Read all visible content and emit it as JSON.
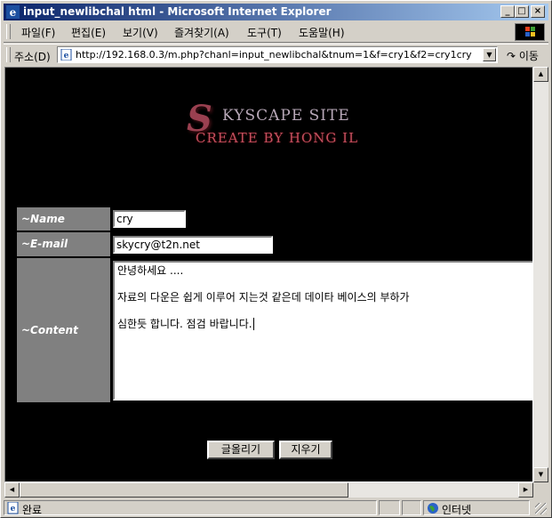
{
  "window": {
    "title": "input_newlibchal html - Microsoft Internet Explorer"
  },
  "titlebar_buttons": {
    "minimize": "_",
    "maximize": "□",
    "close": "×"
  },
  "menu": [
    {
      "label": "파일(F)"
    },
    {
      "label": "편집(E)"
    },
    {
      "label": "보기(V)"
    },
    {
      "label": "즐겨찾기(A)"
    },
    {
      "label": "도구(T)"
    },
    {
      "label": "도움말(H)"
    }
  ],
  "address": {
    "label": "주소(D)",
    "url": "http://192.168.0.3/m.php?chanl=input_newlibchal&tnum=1&f=cry1&f2=cry1cry",
    "go_label": "이동"
  },
  "logo": {
    "big_letter": "S",
    "line1": "KYSCAPE SITE",
    "line2": "CREATE BY HONG IL"
  },
  "form": {
    "name_label": "~Name",
    "name_value": "cry",
    "email_label": "~E-mail",
    "email_value": "skycry@t2n.net",
    "content_label": "~Content",
    "content_lines": [
      "안녕하세요 ....",
      "자료의 다운은 쉽게 이루어 지는것 같은데 데이타 베이스의 부하가",
      "심한듯 합니다. 점검 바랍니다."
    ],
    "submit_label": "글올리기",
    "reset_label": "지우기"
  },
  "status": {
    "text": "완료",
    "zone": "인터넷"
  },
  "colors": {
    "titlebar_start": "#0a246a",
    "titlebar_end": "#a6caf0",
    "page_background": "#000000",
    "label_background": "#808080"
  }
}
